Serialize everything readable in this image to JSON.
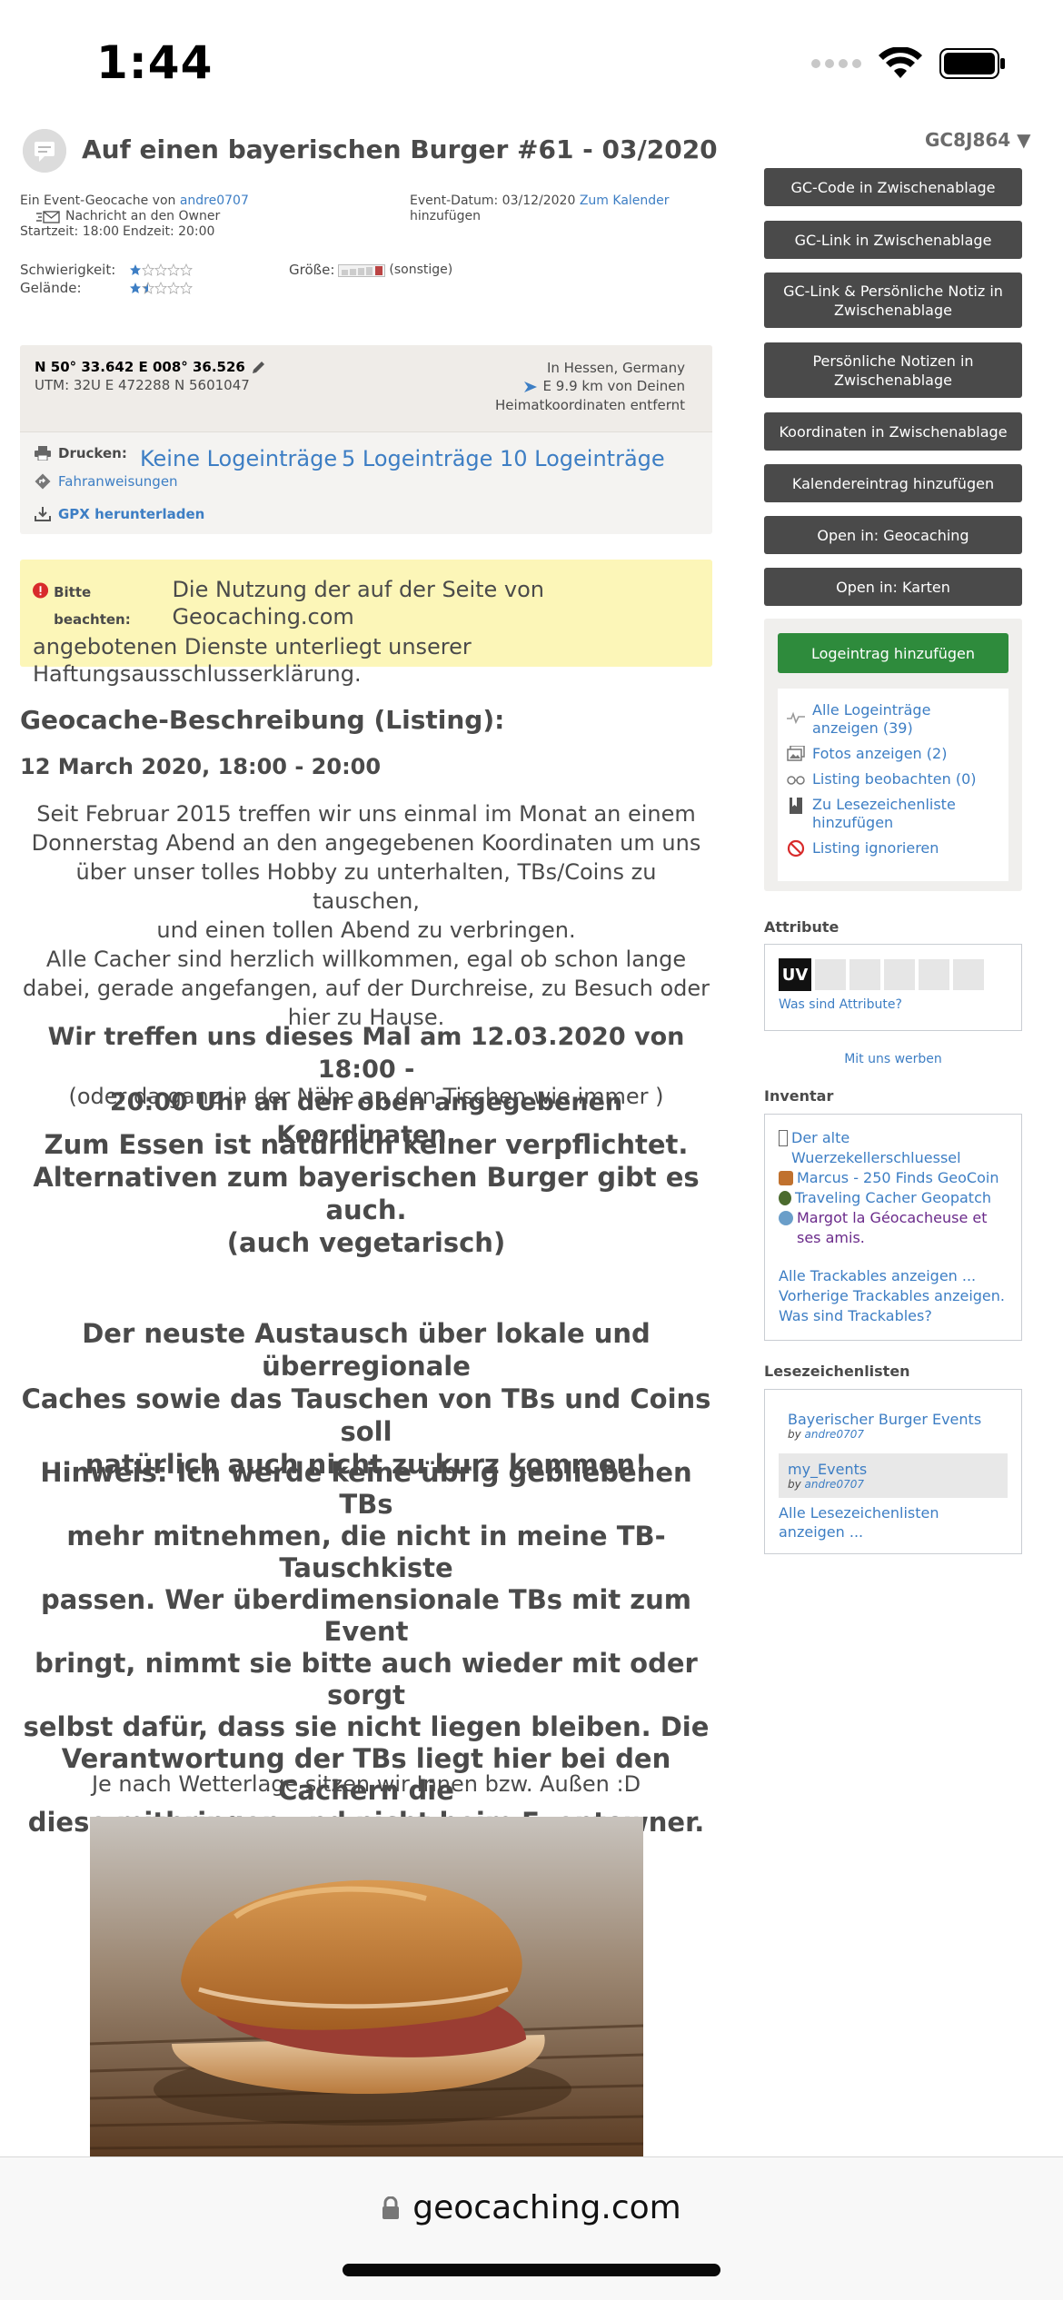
{
  "status_bar": {
    "time": "1:44"
  },
  "header": {
    "title": "Auf einen bayerischen Burger #61 - 03/2020",
    "gc_code": "GC8J864 ▼"
  },
  "event_info": {
    "owner_prefix": "Ein Event-Geocache von",
    "owner_name": "andre0707",
    "message_owner": "Nachricht an den Owner",
    "start": "Startzeit: 18:00",
    "end": "Endzeit: 20:00",
    "date": "Event-Datum: 03/12/2020",
    "add_calendar_1": "Zum Kalender",
    "add_calendar_2": "hinzufügen",
    "difficulty_label": "Schwierigkeit:",
    "terrain_label": "Gelände:",
    "size_label": "Größe:",
    "size_value": "(sonstige)",
    "difficulty": 1,
    "terrain": 1.5
  },
  "coords": {
    "main": "N 50° 33.642 E 008° 36.526",
    "utm": "UTM: 32U E 472288 N 5601047",
    "region": "In Hessen, Germany",
    "distance": "E 9.9 km von Deinen",
    "distance_2": "Heimatkoordinaten entfernt",
    "print_label": "Drucken:",
    "print_none": "Keine Logeinträge",
    "print_5": "5 Logeinträge",
    "print_10": "10 Logeinträge",
    "directions": "Fahranweisungen",
    "gpx": "GPX herunterladen"
  },
  "notice": {
    "label": "Bitte beachten:",
    "text_1": "Die Nutzung der auf der Seite von Geocaching.com",
    "text_2": "angebotenen Dienste unterliegt unserer",
    "text_3": "Haftungsausschlusserklärung."
  },
  "description": {
    "heading": "Geocache-Beschreibung (Listing):",
    "date_line": "12 March 2020, 18:00 - 20:00",
    "p1": [
      "Seit Februar 2015 treffen wir uns einmal im Monat an einem",
      "Donnerstag Abend an den angegebenen Koordinaten um uns",
      "über unser tolles Hobby zu unterhalten, TBs/Coins zu tauschen,",
      "und einen tollen Abend zu verbringen.",
      "Alle Cacher sind herzlich willkommen, egal ob schon lange",
      "dabei, gerade angefangen, auf der Durchreise, zu Besuch oder",
      "hier zu Hause."
    ],
    "p2": [
      "Wir treffen uns dieses Mal am 12.03.2020 von 18:00 -",
      "20:00 Uhr an den oben angegebenen Koordinaten."
    ],
    "p2_sub": "(oder da ganz in der Nähe an den Tischen wie immer )",
    "p3": [
      "Zum Essen ist natürlich keiner verpflichtet.",
      "Alternativen zum bayerischen Burger gibt es auch.",
      "(auch vegetarisch)"
    ],
    "p4": [
      "Der neuste Austausch über lokale und überregionale",
      "Caches sowie das Tauschen von TBs und Coins soll",
      "natürlich auch nicht zu kurz kommen!"
    ],
    "p5": [
      "Hinweis: Ich werde keine übrig gebliebenen TBs",
      "mehr mitnehmen, die nicht in meine TB-Tauschkiste",
      "passen. Wer überdimensionale TBs mit zum Event",
      "bringt, nimmt sie bitte auch wieder mit oder sorgt",
      "selbst dafür, dass sie nicht liegen bleiben. Die",
      "Verantwortung der TBs liegt hier bei den Cachern die",
      "diese mitbringen und nicht beim Eventowner."
    ],
    "p6": "Je nach Wetterlage sitzen wir Innen bzw. Außen :D"
  },
  "sidebar": {
    "buttons": [
      "GC-Code in Zwischenablage",
      "GC-Link in Zwischenablage",
      "GC-Link & Persönliche Notiz in Zwischenablage",
      "Persönliche Notizen in Zwischenablage",
      "Koordinaten in Zwischenablage",
      "Kalendereintrag hinzufügen",
      "Open in: Geocaching",
      "Open in: Karten"
    ],
    "log_button": "Logeintrag hinzufügen",
    "links": [
      "Alle Logeinträge anzeigen (39)",
      "Fotos anzeigen (2)",
      "Listing beobachten (0)",
      "Zu Lesezeichenliste hinzufügen",
      "Listing ignorieren"
    ],
    "attributes_title": "Attribute",
    "attribute_uv": "UV",
    "attributes_link": "Was sind Attribute?",
    "advertise": "Mit uns werben",
    "inventory_title": "Inventar",
    "inventory": [
      "Der alte Wuerzekellerschluessel",
      "Marcus - 250 Finds GeoCoin",
      "Traveling Cacher Geopatch",
      "Margot la Géocacheuse et ses amis."
    ],
    "trackable_links": [
      "Alle Trackables anzeigen ...",
      "Vorherige Trackables anzeigen.",
      "Was sind Trackables?"
    ],
    "bookmarks_title": "Lesezeichenlisten",
    "bookmarks": [
      {
        "name": "Bayerischer Burger Events",
        "by": "by",
        "owner": "andre0707"
      },
      {
        "name": "my_Events",
        "by": "by",
        "owner": "andre0707"
      }
    ],
    "bookmarks_all": "Alle Lesezeichenlisten anzeigen ..."
  },
  "browser": {
    "url": "geocaching.com"
  }
}
